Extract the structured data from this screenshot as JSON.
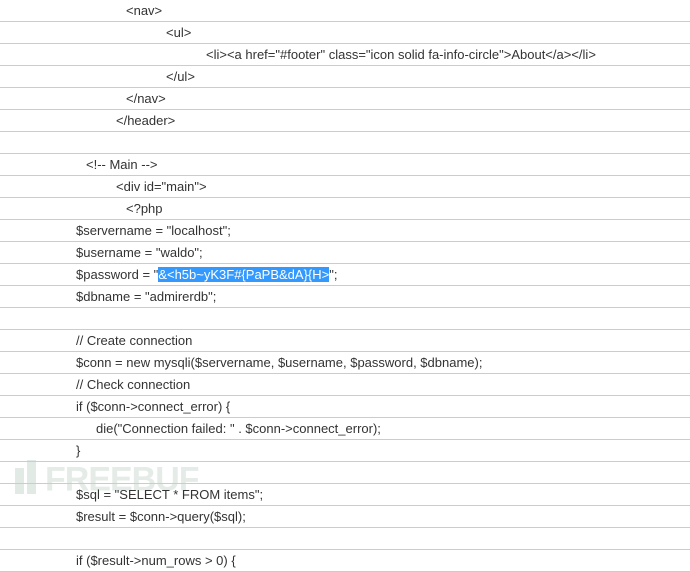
{
  "lines": [
    {
      "indent": 120,
      "text": "<nav>"
    },
    {
      "indent": 160,
      "text": "<ul>"
    },
    {
      "indent": 200,
      "text": "<li><a href=\"#footer\" class=\"icon solid fa-info-circle\">About</a></li>"
    },
    {
      "indent": 160,
      "text": "</ul>"
    },
    {
      "indent": 120,
      "text": "</nav>"
    },
    {
      "indent": 110,
      "text": "</header>"
    },
    {
      "indent": 0,
      "text": ""
    },
    {
      "indent": 80,
      "text": "<!-- Main -->"
    },
    {
      "indent": 110,
      "text": "<div id=\"main\">"
    },
    {
      "indent": 120,
      "text": "<?php"
    },
    {
      "indent": 70,
      "text": "$servername = \"localhost\";"
    },
    {
      "indent": 70,
      "text": "$username = \"waldo\";"
    },
    {
      "indent": 70,
      "prefix": "$password = \"",
      "highlighted": "&<h5b~yK3F#{PaPB&dA}{H>",
      "suffix": "\";"
    },
    {
      "indent": 70,
      "text": "$dbname = \"admirerdb\";"
    },
    {
      "indent": 0,
      "text": ""
    },
    {
      "indent": 70,
      "text": "// Create connection"
    },
    {
      "indent": 70,
      "text": "$conn = new mysqli($servername, $username, $password, $dbname);"
    },
    {
      "indent": 70,
      "text": "// Check connection"
    },
    {
      "indent": 70,
      "text": "if ($conn->connect_error) {"
    },
    {
      "indent": 90,
      "text": "die(\"Connection failed: \" . $conn->connect_error);"
    },
    {
      "indent": 70,
      "text": "}"
    },
    {
      "indent": 0,
      "text": ""
    },
    {
      "indent": 70,
      "text": "$sql = \"SELECT * FROM items\";"
    },
    {
      "indent": 70,
      "text": "$result = $conn->query($sql);"
    },
    {
      "indent": 0,
      "text": ""
    },
    {
      "indent": 70,
      "text": "if ($result->num_rows > 0) {"
    }
  ],
  "watermark": "FREEBUF"
}
